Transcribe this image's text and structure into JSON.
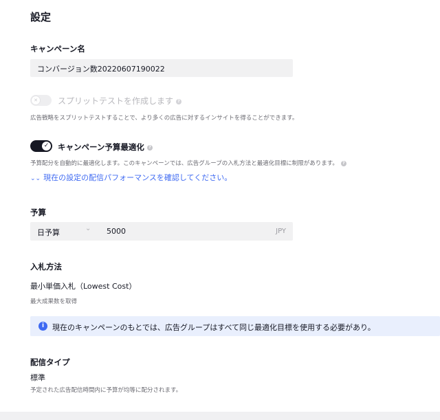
{
  "page_title": "設定",
  "campaign_name": {
    "label": "キャンペーン名",
    "value": "コンバージョン数20220607190022"
  },
  "split_test": {
    "label": "スプリットテストを作成します",
    "description": "広告戦略をスプリットテストすることで、より多くの広告に対するインサイトを得ることができます。",
    "enabled": false
  },
  "cbo": {
    "label": "キャンペーン予算最適化",
    "enabled": true,
    "description": "予算配分を自動的に最適化します。このキャンペーンでは、広告グループの入札方法と最適化目標に制限があります。",
    "link_text": "現在の設定の配信パフォーマンスを確認してください。"
  },
  "budget": {
    "label": "予算",
    "type_value": "日予算",
    "amount": "5000",
    "currency": "JPY"
  },
  "bid": {
    "label": "入札方法",
    "method": "最小単価入札（Lowest Cost）",
    "description": "最大成果数を取得"
  },
  "info_banner": {
    "text": "現在のキャンペーンのもとでは、広告グループはすべて同じ最適化目標を使用する必要があり。"
  },
  "delivery": {
    "label": "配信タイプ",
    "value": "標準",
    "description": "予定された広告配信時間内に予算が均等に配分されます。"
  },
  "colors": {
    "accent_blue": "#3f6af2",
    "toggle_on": "#161823",
    "toggle_off": "#e6e6e9",
    "input_bg": "#f1f1f2",
    "info_bg": "#e9effd"
  },
  "icons": [
    "help-icon",
    "check-icon",
    "double-chevron-down-icon",
    "chevron-down-icon",
    "info-icon"
  ]
}
